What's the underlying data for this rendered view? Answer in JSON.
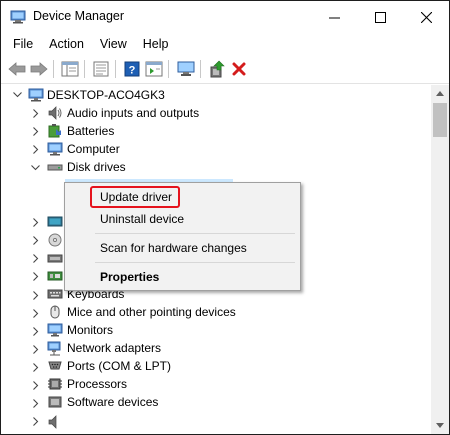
{
  "window": {
    "title": "Device Manager"
  },
  "menu": [
    "File",
    "Action",
    "View",
    "Help"
  ],
  "tree": {
    "root": "DESKTOP-ACO4GK3",
    "items": [
      "Audio inputs and outputs",
      "Batteries",
      "Computer",
      "Disk drives",
      "Keyboards",
      "Mice and other pointing devices",
      "Monitors",
      "Network adapters",
      "Ports (COM & LPT)",
      "Processors",
      "Software devices"
    ]
  },
  "context_menu": {
    "update": "Update driver",
    "uninstall": "Uninstall device",
    "scan": "Scan for hardware changes",
    "properties": "Properties"
  },
  "colors": {
    "highlight_box": "#e5131d",
    "selection": "#cce8ff",
    "scrollbar": "#f0f0f0"
  }
}
